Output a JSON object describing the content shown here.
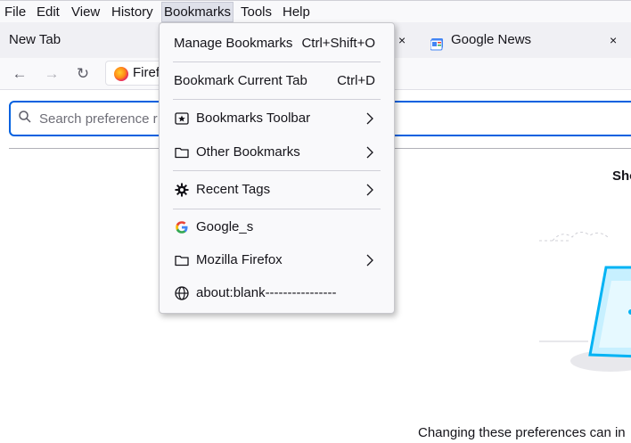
{
  "menubar": {
    "items": [
      "File",
      "Edit",
      "View",
      "History",
      "Bookmarks",
      "Tools",
      "Help"
    ]
  },
  "tabs": [
    {
      "label": "New Tab",
      "close": "×"
    },
    {
      "label": "Google News",
      "close": "×",
      "icon": "google-news-icon"
    }
  ],
  "navbar": {
    "back_icon": "←",
    "forward_icon": "→",
    "reload_icon": "↻",
    "url_text": "Firef"
  },
  "page": {
    "search_placeholder": "Search preference r",
    "heading_fragment": "Sho",
    "footnote": "Changing these preferences can in"
  },
  "bookmarks_menu": {
    "manage": {
      "label": "Manage Bookmarks",
      "shortcut": "Ctrl+Shift+O"
    },
    "bookmark_current": {
      "label": "Bookmark Current Tab",
      "shortcut": "Ctrl+D"
    },
    "toolbar": {
      "label": "Bookmarks Toolbar",
      "icon": "star-icon"
    },
    "other": {
      "label": "Other Bookmarks",
      "icon": "folder-icon"
    },
    "recent_tags": {
      "label": "Recent Tags",
      "icon": "gear-icon"
    },
    "google": {
      "label": "Google_s",
      "icon": "google-icon"
    },
    "mozilla": {
      "label": "Mozilla Firefox",
      "icon": "folder-icon"
    },
    "about_blank": {
      "label": "about:blank----------------",
      "icon": "globe-icon"
    }
  },
  "colors": {
    "accent": "#0061e0",
    "menu_bg": "#f9f9fb",
    "tabstrip_bg": "#f0f0f4",
    "menubar_active": "#dfe1ea"
  }
}
